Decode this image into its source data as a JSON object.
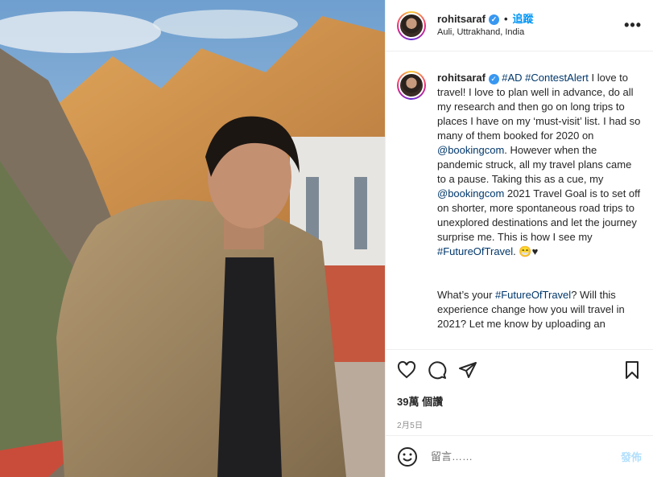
{
  "post": {
    "username": "rohitsaraf",
    "dot": "•",
    "follow_label": "追蹤",
    "location": "Auli, Uttrakhand, India",
    "more_label": "•••"
  },
  "caption": {
    "username": "rohitsaraf",
    "p1_tags": "#AD #ContestAlert",
    "p1_a": " I love to travel! I love to plan well in advance, do all my research and then go on long trips to places I have on my ‘must-visit’ list. I had so many of them booked for 2020 on ",
    "mention1": "@bookingcom",
    "p1_b": ". However when the pandemic struck, all my travel plans came to a pause. Taking this as a cue, my ",
    "mention2": "@bookingcom",
    "p1_c": " 2021 Travel Goal is to set off on shorter, more spontaneous road trips to unexplored destinations and let the journey surprise me. This is how I see my ",
    "tag_future": "#FutureOfTravel",
    "p1_d": ". 😁♥",
    "p2_a": "What’s your ",
    "tag_future2": "#FutureOfTravel",
    "p2_b": "? Will this experience change how you will travel in 2021? Let me know by uploading an"
  },
  "stats": {
    "likes": "39萬 個讚",
    "date": "2月5日"
  },
  "comment": {
    "placeholder": "留言……",
    "post_label": "發佈"
  }
}
